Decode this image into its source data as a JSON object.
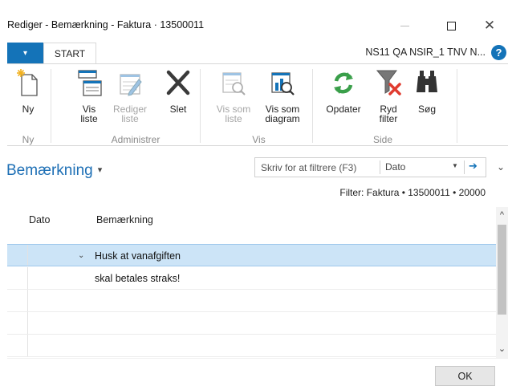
{
  "window": {
    "title": "Rediger - Bemærkning - Faktura · 13500011",
    "minimize": "—",
    "close": "✕"
  },
  "tabs": {
    "file_glyph": "▾",
    "start": "START",
    "company": "NS11 QA NSIR_1 TNV N...",
    "help": "?"
  },
  "ribbon": {
    "buttons": {
      "new": "Ny",
      "show_list_1": "Vis",
      "show_list_2": "liste",
      "edit_list_1": "Rediger",
      "edit_list_2": "liste",
      "delete": "Slet",
      "view_list_1": "Vis som",
      "view_list_2": "liste",
      "view_chart_1": "Vis som",
      "view_chart_2": "diagram",
      "refresh": "Opdater",
      "clear_filter_1": "Ryd",
      "clear_filter_2": "filter",
      "search": "Søg"
    },
    "groups": {
      "new": "Ny",
      "manage": "Administrer",
      "view": "Vis",
      "page": "Side"
    }
  },
  "page": {
    "title": "Bemærkning",
    "title_caret": "▾",
    "filter_placeholder": "Skriv for at filtrere (F3)",
    "filter_field": "Dato",
    "filter_dd": "▼",
    "filter_go": "➔",
    "collapse": "⌄",
    "filter_summary": "Filter: Faktura • 13500011 • 20000"
  },
  "grid": {
    "columns": [
      "Dato",
      "Bemærkning"
    ],
    "rows": [
      {
        "date": "",
        "text": "Husk at vanafgiften",
        "selected": true
      },
      {
        "date": "",
        "text": "skal betales straks!",
        "selected": false
      },
      {
        "date": "",
        "text": "",
        "selected": false
      },
      {
        "date": "",
        "text": "",
        "selected": false
      },
      {
        "date": "",
        "text": "",
        "selected": false
      }
    ],
    "row_chevron": "⌄"
  },
  "scrollbar": {
    "up": "^",
    "down": "⌄"
  },
  "footer": {
    "ok": "OK"
  },
  "colors": {
    "accent": "#1473b8",
    "title_blue": "#1d6fb5",
    "selected_row": "#cce4f7",
    "refresh_green": "#3a9f4a",
    "clear_filter_red": "#e03b2f"
  }
}
